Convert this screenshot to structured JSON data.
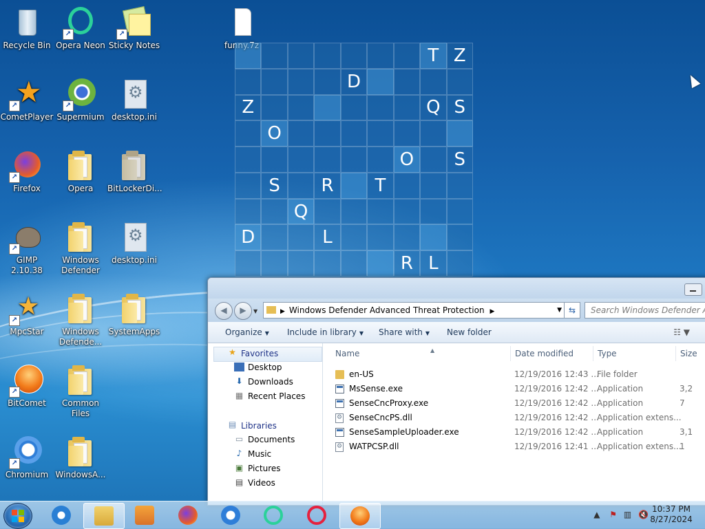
{
  "desktop": {
    "icons": [
      {
        "label": "Recycle Bin"
      },
      {
        "label": "Opera Neon"
      },
      {
        "label": "Sticky Notes"
      },
      {
        "label": "funny.7z"
      },
      {
        "label": "CometPlayer"
      },
      {
        "label": "Supermium"
      },
      {
        "label": "desktop.ini"
      },
      {
        "label": "Firefox"
      },
      {
        "label": "Opera"
      },
      {
        "label": "BitLockerDi..."
      },
      {
        "label": "GIMP 2.10.38"
      },
      {
        "label": "Windows Defender"
      },
      {
        "label": "desktop.ini"
      },
      {
        "label": "MpcStar"
      },
      {
        "label": "Windows Defende..."
      },
      {
        "label": "SystemApps"
      },
      {
        "label": "BitComet"
      },
      {
        "label": "Common Files"
      },
      {
        "label": "Chromium"
      },
      {
        "label": "WindowsA..."
      }
    ]
  },
  "grid": {
    "rows": [
      [
        "",
        "",
        "",
        "",
        "",
        "",
        "",
        "T",
        "Z"
      ],
      [
        "",
        "",
        "",
        "",
        "D",
        "",
        "",
        "",
        ""
      ],
      [
        "Z",
        "",
        "",
        "",
        "",
        "",
        "",
        "Q",
        "S"
      ],
      [
        "",
        "O",
        "",
        "",
        "",
        "",
        "",
        "",
        ""
      ],
      [
        "",
        "",
        "",
        "",
        "",
        "",
        "O",
        "",
        "S"
      ],
      [
        "",
        "S",
        "",
        "R",
        "",
        "T",
        "",
        "",
        ""
      ],
      [
        "",
        "",
        "Q",
        "",
        "",
        "",
        "",
        "",
        ""
      ],
      [
        "D",
        "",
        "",
        "L",
        "",
        "",
        "",
        "",
        ""
      ],
      [
        "",
        "",
        "",
        "",
        "",
        "",
        "R",
        "L",
        ""
      ]
    ]
  },
  "explorer": {
    "address_path": "Windows Defender Advanced Threat Protection",
    "search_placeholder": "Search Windows Defender Advanced Threat Protection",
    "toolbar": {
      "organize": "Organize",
      "include_in_library": "Include in library",
      "share_with": "Share with",
      "new_folder": "New folder"
    },
    "nav": {
      "favorites": "Favorites",
      "desktop": "Desktop",
      "downloads": "Downloads",
      "recent_places": "Recent Places",
      "libraries": "Libraries",
      "documents": "Documents",
      "music": "Music",
      "pictures": "Pictures",
      "videos": "Videos"
    },
    "columns": {
      "name": "Name",
      "date_modified": "Date modified",
      "type": "Type",
      "size": "Size"
    },
    "files": [
      {
        "name": "en-US",
        "date": "12/19/2016 12:43 ...",
        "type": "File folder",
        "size": "",
        "icon": "folder"
      },
      {
        "name": "MsSense.exe",
        "date": "12/19/2016 12:42 ...",
        "type": "Application",
        "size": "3,2",
        "icon": "app"
      },
      {
        "name": "SenseCncProxy.exe",
        "date": "12/19/2016 12:42 ...",
        "type": "Application",
        "size": "7",
        "icon": "app"
      },
      {
        "name": "SenseCncPS.dll",
        "date": "12/19/2016 12:42 ...",
        "type": "Application extens...",
        "size": "",
        "icon": "dll"
      },
      {
        "name": "SenseSampleUploader.exe",
        "date": "12/19/2016 12:42 ...",
        "type": "Application",
        "size": "3,1",
        "icon": "app"
      },
      {
        "name": "WATPCSP.dll",
        "date": "12/19/2016 12:41 ...",
        "type": "Application extens...",
        "size": "1",
        "icon": "dll"
      }
    ]
  },
  "taskbar": {
    "time": "10:37 PM",
    "date": "8/27/2024"
  }
}
